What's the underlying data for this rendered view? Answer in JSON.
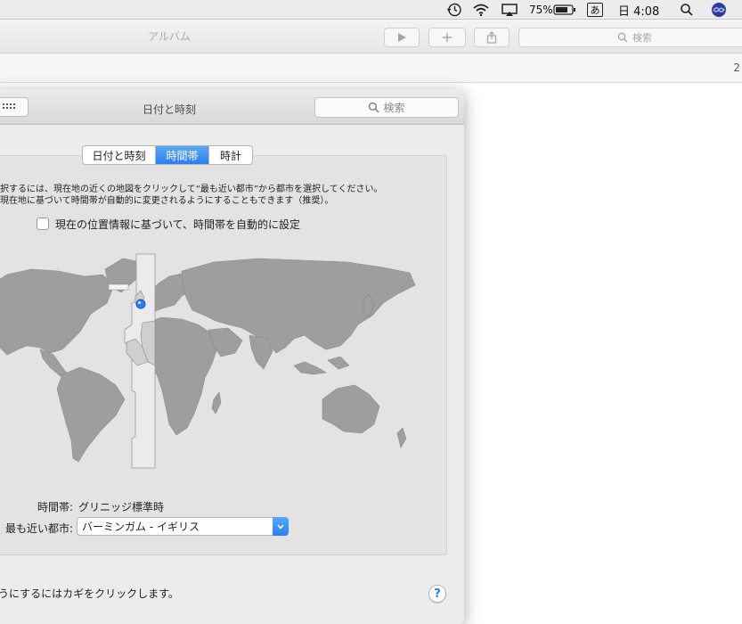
{
  "menubar": {
    "battery_percent": "75%",
    "input_method": "あ",
    "clock": "日 4:08"
  },
  "photos": {
    "title": "アルバム",
    "search_placeholder": "検索",
    "count": "2"
  },
  "prefs": {
    "title": "日付と時刻",
    "search_placeholder": "検索",
    "tabs": [
      {
        "label": "日付と時刻",
        "active": false
      },
      {
        "label": "時間帯",
        "active": true
      },
      {
        "label": "時計",
        "active": false
      }
    ],
    "desc_line1": "択するには、現在地の近くの地図をクリックして“最も近い都市”から都市を選択してください。",
    "desc_line2": "現在地に基づいて時間帯が自動的に変更されるようにすることもできます（推奨）。",
    "auto_checkbox_label": "現在の位置情報に基づいて、時間帯を自動的に設定",
    "auto_checked": false,
    "timezone_label": "時間帯:",
    "timezone_value": "グリニッジ標準時",
    "city_label": "最も近い都市:",
    "city_value": "バーミンガム - イギリス",
    "lock_text": "うにするにはカギをクリックします。",
    "help": "?"
  },
  "colors": {
    "accent": "#2a7ef0",
    "land": "#9e9e9e",
    "highlight_band": "#ebebeb"
  }
}
